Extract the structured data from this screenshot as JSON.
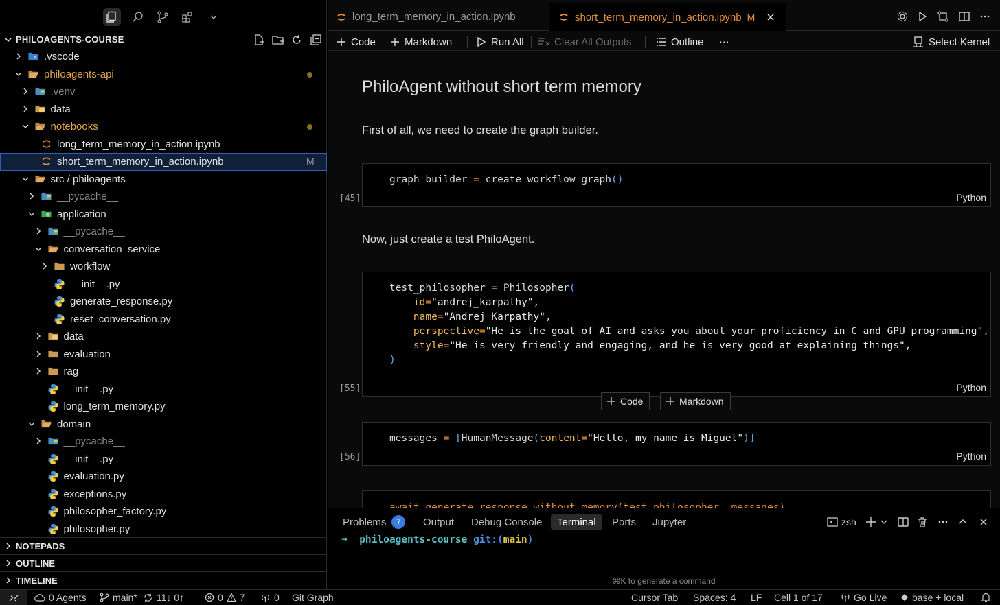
{
  "explorer": {
    "title": "PHILOAGENTS-COURSE",
    "tree": [
      {
        "label": ".vscode",
        "indent": 0,
        "kind": "folder-vscode",
        "expanded": false,
        "style": "norm"
      },
      {
        "label": "philoagents-api",
        "indent": 0,
        "kind": "folder-open",
        "expanded": true,
        "style": "mod",
        "dot": true
      },
      {
        "label": ".venv",
        "indent": 1,
        "kind": "folder-py",
        "expanded": false,
        "style": "dim"
      },
      {
        "label": "data",
        "indent": 1,
        "kind": "folder-db",
        "expanded": false,
        "style": "norm"
      },
      {
        "label": "notebooks",
        "indent": 1,
        "kind": "folder-open-nb",
        "expanded": true,
        "style": "mod",
        "dot": true
      },
      {
        "label": "long_term_memory_in_action.ipynb",
        "indent": 2,
        "kind": "jupyter",
        "style": "norm"
      },
      {
        "label": "short_term_memory_in_action.ipynb",
        "indent": 2,
        "kind": "jupyter",
        "style": "norm",
        "selected": true,
        "mark": "M"
      },
      {
        "label": "src / philoagents",
        "indent": 1,
        "kind": "folder-open",
        "expanded": true,
        "style": "norm"
      },
      {
        "label": "__pycache__",
        "indent": 2,
        "kind": "folder-py",
        "expanded": false,
        "style": "dim"
      },
      {
        "label": "application",
        "indent": 2,
        "kind": "folder-app",
        "expanded": true,
        "style": "norm"
      },
      {
        "label": "__pycache__",
        "indent": 3,
        "kind": "folder-py",
        "expanded": false,
        "style": "dim"
      },
      {
        "label": "conversation_service",
        "indent": 3,
        "kind": "folder-open",
        "expanded": true,
        "style": "norm"
      },
      {
        "label": "workflow",
        "indent": 4,
        "kind": "folder",
        "expanded": false,
        "style": "norm"
      },
      {
        "label": "__init__.py",
        "indent": 4,
        "kind": "python",
        "style": "norm"
      },
      {
        "label": "generate_response.py",
        "indent": 4,
        "kind": "python",
        "style": "norm"
      },
      {
        "label": "reset_conversation.py",
        "indent": 4,
        "kind": "python",
        "style": "norm"
      },
      {
        "label": "data",
        "indent": 3,
        "kind": "folder-db",
        "expanded": false,
        "style": "norm"
      },
      {
        "label": "evaluation",
        "indent": 3,
        "kind": "folder",
        "expanded": false,
        "style": "norm"
      },
      {
        "label": "rag",
        "indent": 3,
        "kind": "folder",
        "expanded": false,
        "style": "norm"
      },
      {
        "label": "__init__.py",
        "indent": 3,
        "kind": "python",
        "style": "norm"
      },
      {
        "label": "long_term_memory.py",
        "indent": 3,
        "kind": "python",
        "style": "norm"
      },
      {
        "label": "domain",
        "indent": 2,
        "kind": "folder-open",
        "expanded": true,
        "style": "norm"
      },
      {
        "label": "__pycache__",
        "indent": 3,
        "kind": "folder-py",
        "expanded": false,
        "style": "dim"
      },
      {
        "label": "__init__.py",
        "indent": 3,
        "kind": "python",
        "style": "norm"
      },
      {
        "label": "evaluation.py",
        "indent": 3,
        "kind": "python",
        "style": "norm"
      },
      {
        "label": "exceptions.py",
        "indent": 3,
        "kind": "python",
        "style": "norm"
      },
      {
        "label": "philosopher_factory.py",
        "indent": 3,
        "kind": "python",
        "style": "norm"
      },
      {
        "label": "philosopher.py",
        "indent": 3,
        "kind": "python",
        "style": "norm"
      }
    ],
    "panels": [
      "NOTEPADS",
      "OUTLINE",
      "TIMELINE"
    ]
  },
  "tabs": [
    {
      "name": "long_term_memory_in_action.ipynb",
      "active": false
    },
    {
      "name": "short_term_memory_in_action.ipynb",
      "active": true,
      "mark": "M"
    }
  ],
  "toolbar": {
    "code": "Code",
    "markdown": "Markdown",
    "run_all": "Run All",
    "clear_outputs": "Clear All Outputs",
    "outline": "Outline",
    "more": "⋯",
    "select_kernel": "Select Kernel"
  },
  "notebook": {
    "heading": "PhiloAgent without short term memory",
    "para1": "First of all, we need to create the graph builder.",
    "cell1_exec": "[45]",
    "cell1_code": "graph_builder = create_workflow_graph()",
    "para2": "Now, just create a test PhiloAgent.",
    "cell2_exec": "[55]",
    "cell2_lines": [
      "test_philosopher = Philosopher(",
      "    id=\"andrej_karpathy\",",
      "    name=\"Andrej Karpathy\",",
      "    perspective=\"He is the goat of AI and asks you about your proficiency in C and GPU programming\",",
      "    style=\"He is very friendly and engaging, and he is very good at explaining things\",",
      ")"
    ],
    "cell3_exec": "[56]",
    "cell3_code": "messages = [HumanMessage(content=\"Hello, my name is Miguel\")]",
    "cell4_code": "await generate_response_without_memory(test_philosopher, messages)",
    "language": "Python",
    "add_code": "Code",
    "add_markdown": "Markdown"
  },
  "panel": {
    "tabs": [
      "Problems",
      "Output",
      "Debug Console",
      "Terminal",
      "Ports",
      "Jupyter"
    ],
    "active": "Terminal",
    "problems_count": "7",
    "shell": "zsh",
    "prompt_arrow": "➜",
    "prompt_dir": "philoagents-course",
    "prompt_git": "git:(",
    "prompt_branch": "main",
    "prompt_close": ")",
    "hint": "⌘K to generate a command"
  },
  "status": {
    "agents": "0 Agents",
    "branch": "main*",
    "sync": "11↓ 0↑",
    "errors": "0",
    "warnings": "7",
    "ports": "0",
    "git_graph": "Git Graph",
    "cursor_tab": "Cursor Tab",
    "spaces": "Spaces: 4",
    "eol": "LF",
    "cell": "Cell 1 of 17",
    "go_live": "Go Live",
    "env": "base + local"
  }
}
